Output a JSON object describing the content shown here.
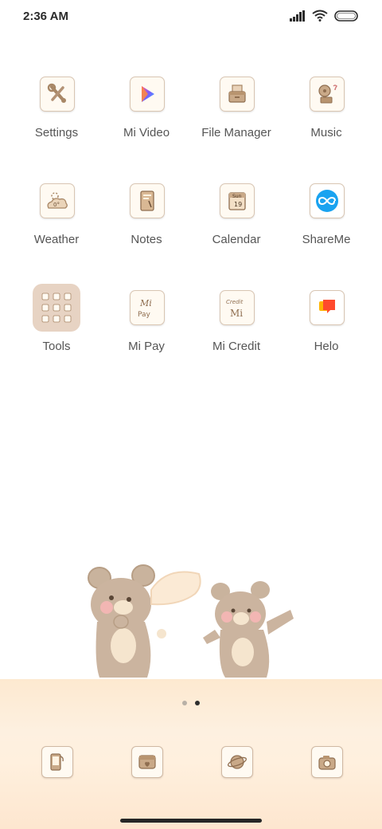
{
  "status_bar": {
    "time": "2:36 AM"
  },
  "apps": [
    {
      "label": "Settings"
    },
    {
      "label": "Mi Video"
    },
    {
      "label": "File Manager"
    },
    {
      "label": "Music"
    },
    {
      "label": "Weather",
      "icon_text": "0°"
    },
    {
      "label": "Notes"
    },
    {
      "label": "Calendar",
      "icon_text_top": "Sun",
      "icon_text_bottom": "19"
    },
    {
      "label": "ShareMe"
    },
    {
      "label": "Tools"
    },
    {
      "label": "Mi Pay",
      "icon_text_top": "Mi",
      "icon_text_bottom": "Pay"
    },
    {
      "label": "Mi Credit",
      "icon_text_top": "Credit",
      "icon_text_bottom": "Mi"
    },
    {
      "label": "Helo"
    }
  ],
  "page_indicator": {
    "pages": 2,
    "active": 2
  },
  "dock": [
    {
      "icon": "phone-icon"
    },
    {
      "icon": "message-icon"
    },
    {
      "icon": "browser-planet-icon"
    },
    {
      "icon": "camera-icon"
    }
  ],
  "colors": {
    "icon_bg": "#fffaf2",
    "icon_border": "#d9c6b3",
    "brown": "#a88766",
    "dock_band": "#fde9d0"
  }
}
